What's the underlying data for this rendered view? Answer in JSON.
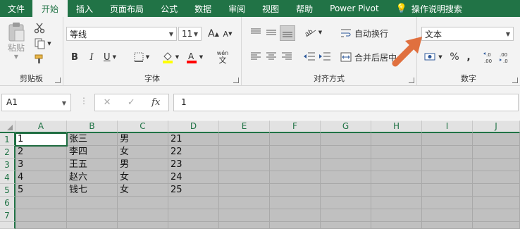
{
  "tabs": [
    {
      "label": "文件",
      "active": false
    },
    {
      "label": "开始",
      "active": true
    },
    {
      "label": "插入",
      "active": false
    },
    {
      "label": "页面布局",
      "active": false
    },
    {
      "label": "公式",
      "active": false
    },
    {
      "label": "数据",
      "active": false
    },
    {
      "label": "审阅",
      "active": false
    },
    {
      "label": "视图",
      "active": false
    },
    {
      "label": "帮助",
      "active": false
    },
    {
      "label": "Power Pivot",
      "active": false
    },
    {
      "label": "操作说明搜索",
      "active": false
    }
  ],
  "clipboard": {
    "paste_label": "粘贴",
    "group_label": "剪贴板"
  },
  "font": {
    "name": "等线",
    "size": "11",
    "grow_label": "A",
    "shrink_label": "A",
    "bold": "B",
    "italic": "I",
    "underline": "U",
    "phonetic_label": "wén",
    "fill_color": "#ffff00",
    "font_color": "#ff0000",
    "group_label": "字体"
  },
  "alignment": {
    "wrap_label": "自动换行",
    "merge_label": "合并后居中",
    "group_label": "对齐方式"
  },
  "number": {
    "format": "文本",
    "percent": "%",
    "comma": ",",
    "group_label": "数字"
  },
  "formula_bar": {
    "name_box": "A1",
    "fx": "fx",
    "value": "1"
  },
  "columns": [
    "A",
    "B",
    "C",
    "D",
    "E",
    "F",
    "G",
    "H",
    "I",
    "J"
  ],
  "rows": [
    {
      "num": "1",
      "cells": [
        "1",
        "张三",
        "男",
        "21"
      ]
    },
    {
      "num": "2",
      "cells": [
        "2",
        "李四",
        "女",
        "22"
      ]
    },
    {
      "num": "3",
      "cells": [
        "3",
        "王五",
        "男",
        "23"
      ]
    },
    {
      "num": "4",
      "cells": [
        "4",
        "赵六",
        "女",
        "24"
      ]
    },
    {
      "num": "5",
      "cells": [
        "5",
        "钱七",
        "女",
        "25"
      ]
    },
    {
      "num": "6",
      "cells": [
        "",
        "",
        "",
        ""
      ]
    },
    {
      "num": "7",
      "cells": [
        "",
        "",
        "",
        ""
      ]
    }
  ],
  "colors": {
    "excel_green": "#217346",
    "arrow": "#e0703f"
  }
}
